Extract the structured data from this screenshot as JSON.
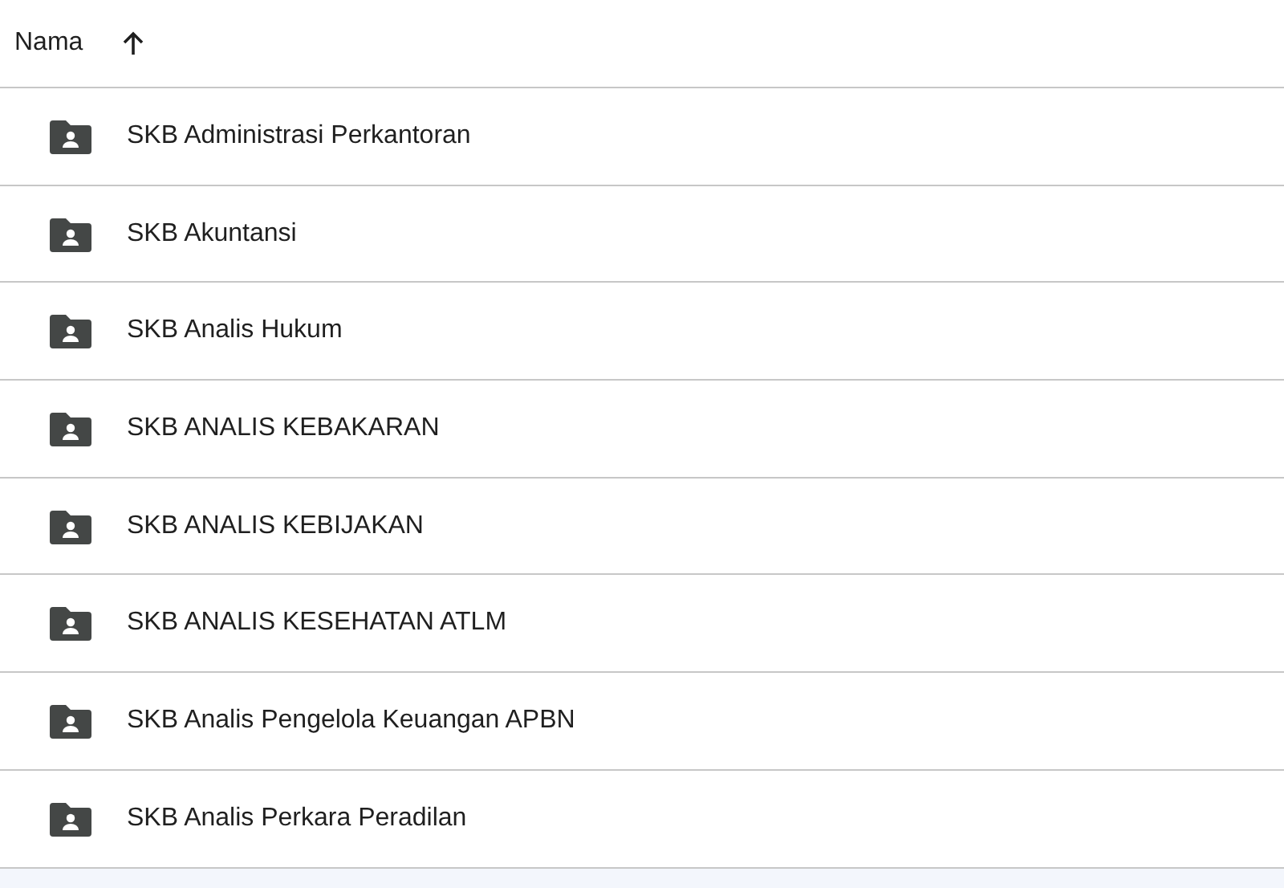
{
  "header": {
    "label": "Nama",
    "sort_ascending": true
  },
  "rows": [
    {
      "name": "SKB Administrasi Perkantoran",
      "kind": "shared-folder"
    },
    {
      "name": "SKB Akuntansi",
      "kind": "shared-folder"
    },
    {
      "name": "SKB Analis Hukum",
      "kind": "shared-folder"
    },
    {
      "name": "SKB ANALIS KEBAKARAN",
      "kind": "shared-folder"
    },
    {
      "name": "SKB ANALIS KEBIJAKAN",
      "kind": "shared-folder"
    },
    {
      "name": "SKB ANALIS KESEHATAN ATLM",
      "kind": "shared-folder"
    },
    {
      "name": "SKB Analis Pengelola Keuangan APBN",
      "kind": "shared-folder"
    },
    {
      "name": "SKB Analis Perkara Peradilan",
      "kind": "shared-folder"
    }
  ]
}
